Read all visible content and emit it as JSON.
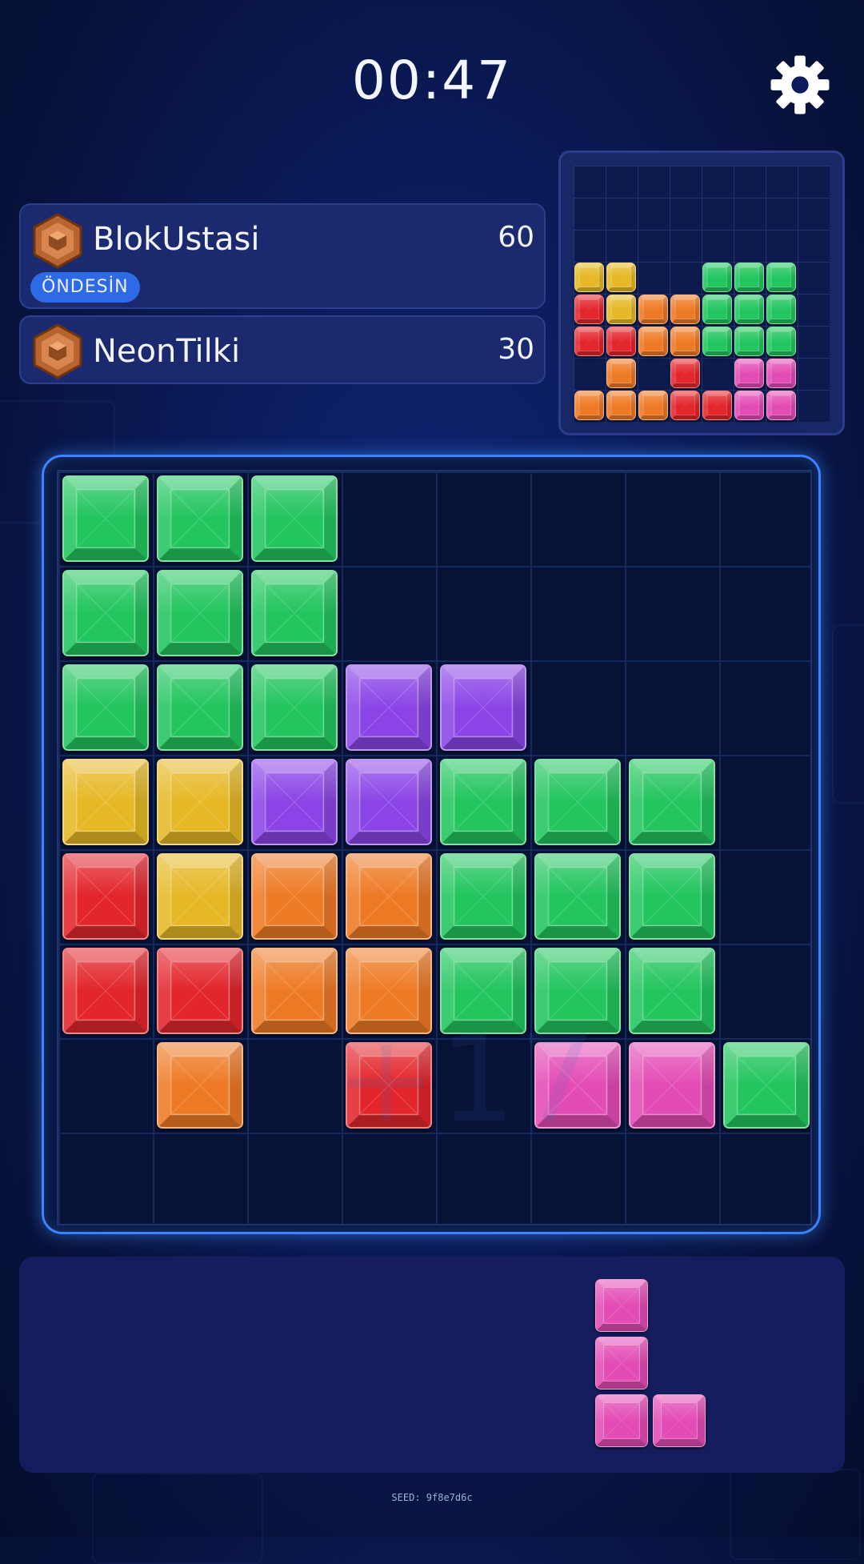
{
  "timer": "00:47",
  "icons": {
    "settings": "gear-icon",
    "rank": "hexagon-rank-badge-icon"
  },
  "players": [
    {
      "name": "BlokUstasi",
      "score": "60",
      "status": "ÖNDESİN"
    },
    {
      "name": "NeonTilki",
      "score": "30"
    }
  ],
  "colors": {
    "green": "#22c55e",
    "purple": "#8b45e6",
    "yellow": "#e6b826",
    "red": "#e2262c",
    "orange": "#ee7a25",
    "pink": "#e34cb5",
    "lead_badge": "#2f6ae6",
    "board_glow": "#3d82ff"
  },
  "board": {
    "size": 8,
    "cells": [
      [
        "green",
        "green",
        "green",
        null,
        null,
        null,
        null,
        null
      ],
      [
        "green",
        "green",
        "green",
        null,
        null,
        null,
        null,
        null
      ],
      [
        "green",
        "green",
        "green",
        "purple",
        "purple",
        null,
        null,
        null
      ],
      [
        "yellow",
        "yellow",
        "purple",
        "purple",
        "green",
        "green",
        "green",
        null
      ],
      [
        "red",
        "yellow",
        "orange",
        "orange",
        "green",
        "green",
        "green",
        null
      ],
      [
        "red",
        "red",
        "orange",
        "orange",
        "green",
        "green",
        "green",
        null
      ],
      [
        null,
        "orange",
        null,
        "red",
        null,
        "pink",
        "pink",
        "green"
      ],
      [
        null,
        null,
        null,
        null,
        null,
        null,
        null,
        null
      ]
    ],
    "watermark": "+17"
  },
  "opponent_board": {
    "size": 8,
    "cells": [
      [
        null,
        null,
        null,
        null,
        null,
        null,
        null,
        null
      ],
      [
        null,
        null,
        null,
        null,
        null,
        null,
        null,
        null
      ],
      [
        null,
        null,
        null,
        null,
        null,
        null,
        null,
        null
      ],
      [
        "yellow",
        "yellow",
        null,
        null,
        "green",
        "green",
        "green",
        null
      ],
      [
        "red",
        "yellow",
        "orange",
        "orange",
        "green",
        "green",
        "green",
        null
      ],
      [
        "red",
        "red",
        "orange",
        "orange",
        "green",
        "green",
        "green",
        null
      ],
      [
        null,
        "orange",
        null,
        "red",
        null,
        "pink",
        "pink",
        null
      ],
      [
        "orange",
        "orange",
        "orange",
        "red",
        "red",
        "pink",
        "pink",
        null
      ]
    ]
  },
  "next_piece": {
    "color": "pink",
    "cells": [
      [
        0,
        0
      ],
      [
        1,
        0
      ],
      [
        2,
        0
      ],
      [
        2,
        1
      ]
    ]
  },
  "seed": "SEED: 9f8e7d6c"
}
